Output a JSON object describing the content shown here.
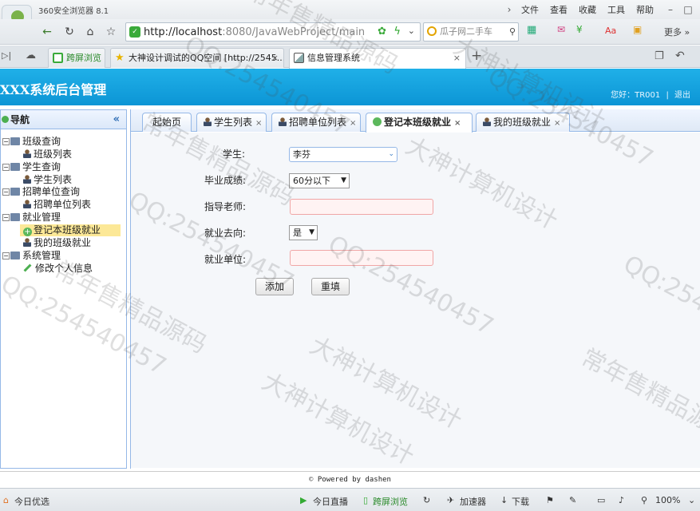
{
  "browser": {
    "title": "360安全浏览器 8.1",
    "menu": [
      "文件",
      "查看",
      "收藏",
      "工具",
      "帮助"
    ],
    "url_host": "http://localhost",
    "url_rest": ":8080/JavaWebProject/main",
    "search_placeholder": "瓜子网二手车",
    "more_label": "更多",
    "tabs": [
      {
        "label": "跨屏浏览"
      },
      {
        "label": "大神设计调试的QQ空间 [http://2545..."
      },
      {
        "label": "信息管理系统"
      }
    ],
    "status": {
      "left": "今日优选",
      "live": "今日直播",
      "cross": "跨屏浏览",
      "speed": "加速器",
      "download": "下载",
      "zoom": "100%"
    }
  },
  "app": {
    "title": "XXX系统后台管理",
    "user_greeting": "您好：TR001",
    "logout": "退出",
    "nav_title": "导航",
    "nav_collapse": "«",
    "tree": [
      {
        "label": "班级查询",
        "level": 0,
        "kind": "folder"
      },
      {
        "label": "班级列表",
        "level": 1,
        "kind": "person"
      },
      {
        "label": "学生查询",
        "level": 0,
        "kind": "folder"
      },
      {
        "label": "学生列表",
        "level": 1,
        "kind": "person"
      },
      {
        "label": "招聘单位查询",
        "level": 0,
        "kind": "folder"
      },
      {
        "label": "招聘单位列表",
        "level": 1,
        "kind": "person"
      },
      {
        "label": "就业管理",
        "level": 0,
        "kind": "folder"
      },
      {
        "label": "登记本班级就业",
        "level": 1,
        "kind": "add",
        "selected": true
      },
      {
        "label": "我的班级就业",
        "level": 1,
        "kind": "person"
      },
      {
        "label": "系统管理",
        "level": 0,
        "kind": "folder"
      },
      {
        "label": "修改个人信息",
        "level": 1,
        "kind": "pencil"
      }
    ],
    "tabs": [
      {
        "label": "起始页",
        "closable": false
      },
      {
        "label": "学生列表",
        "closable": true
      },
      {
        "label": "招聘单位列表",
        "closable": true
      },
      {
        "label": "登记本班级就业",
        "closable": true,
        "active": true
      },
      {
        "label": "我的班级就业",
        "closable": true
      }
    ],
    "form": {
      "student_label": "学生:",
      "student_value": "李芬",
      "grade_label": "毕业成绩:",
      "grade_value": "60分以下",
      "teacher_label": "指导老师:",
      "teacher_value": "",
      "direction_label": "就业去向:",
      "direction_value": "是",
      "company_label": "就业单位:",
      "company_value": "",
      "add_button": "添加",
      "reset_button": "重填"
    },
    "footer": "Powered by dashen"
  },
  "watermark": [
    "常年售精品源码",
    "大神计算机设计",
    "QQ:254540457"
  ]
}
